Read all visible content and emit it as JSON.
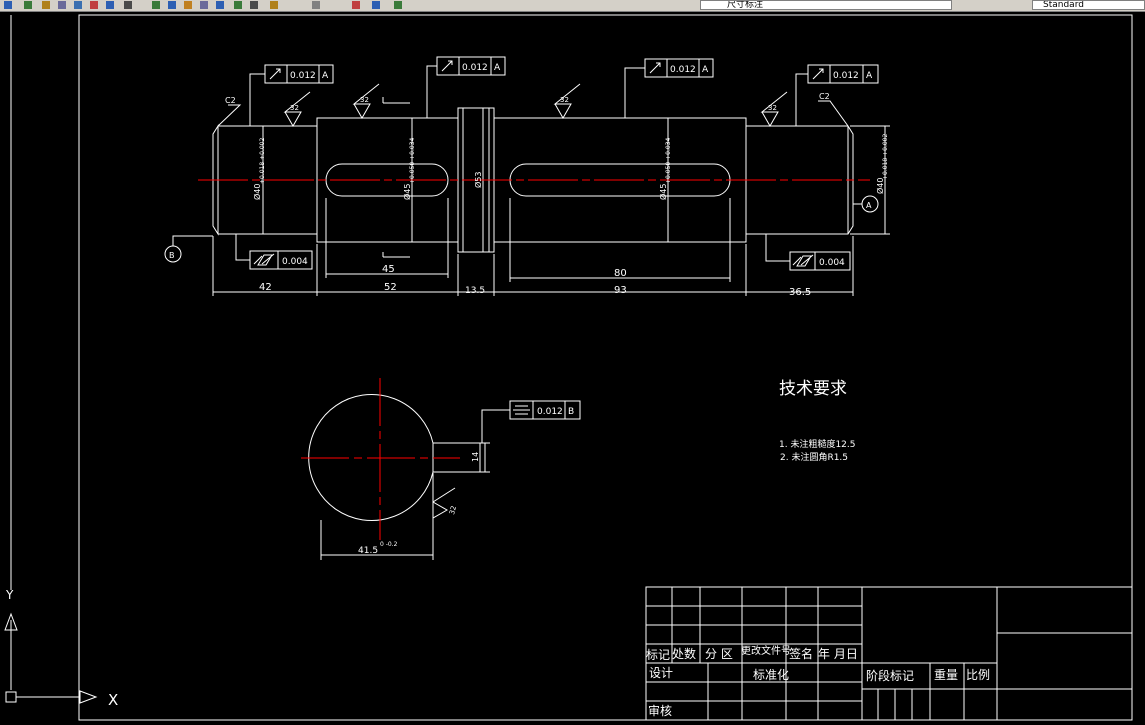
{
  "toolbar": {
    "layer_name": "尺寸标注",
    "text_style": "Standard",
    "icons": [
      "undo-icon",
      "save-icon",
      "cut-icon",
      "copy-icon",
      "paste-icon",
      "match-properties-icon",
      "pan-icon",
      "zoom-realtime-icon",
      "zoom-window-icon",
      "zoom-previous-icon",
      "properties-icon",
      "design-center-icon",
      "tool-palette-icon",
      "sheet-set-icon",
      "markup-icon",
      "calculator-icon",
      "help-icon",
      "layer-manager-icon",
      "layer-state-icon",
      "layer-previous-icon"
    ]
  },
  "drawing": {
    "colors": {
      "background": "#000000",
      "lines": "#ffffff",
      "centerline": "#ff0000"
    },
    "chamfer_labels": [
      "C2",
      "C2"
    ],
    "roughness_values": [
      "32",
      "32",
      "32",
      "32",
      "32"
    ],
    "tolerances": {
      "runout": [
        {
          "symbol": "circular-runout",
          "value": "0.012",
          "datum": "A"
        },
        {
          "symbol": "circular-runout",
          "value": "0.012",
          "datum": "A"
        },
        {
          "symbol": "circular-runout",
          "value": "0.012",
          "datum": "A"
        },
        {
          "symbol": "circular-runout",
          "value": "0.012",
          "datum": "A"
        }
      ],
      "cylindricity": [
        {
          "symbol": "cylindricity",
          "value": "0.004"
        },
        {
          "symbol": "cylindricity",
          "value": "0.004"
        }
      ],
      "symmetry": {
        "symbol": "symmetry",
        "value": "0.012",
        "datum": "B"
      }
    },
    "datums": [
      "A",
      "B"
    ],
    "diameters": {
      "left_journal": "Ø40",
      "left_journal_tol": "+0.018 +0.002",
      "left_keyseat_shaft": "Ø45",
      "left_keyseat_tol": "+0.050 +0.034",
      "collar": "Ø53",
      "right_keyseat_shaft": "Ø45",
      "right_keyseat_tol": "+0.050 +0.034",
      "right_journal": "Ø40",
      "right_journal_tol": "+0.018 +0.002"
    },
    "lengths": {
      "left_journal": "42",
      "left_shaft": "52",
      "left_key": "45",
      "collar": "13.5",
      "right_shaft": "93",
      "right_key": "80",
      "right_journal": "36.5"
    },
    "section": {
      "key_width": "14",
      "depth": "41.5",
      "depth_tol": "0 -0.2",
      "roughness": "32"
    },
    "tech_req": {
      "title": "技术要求",
      "items": [
        "1. 未注粗糙度12.5",
        "2. 未注圆角R1.5"
      ]
    },
    "title_block": {
      "headers": [
        "标记",
        "处数",
        "分 区",
        "更改文件号",
        "签名",
        "年 月日"
      ],
      "design": "设计",
      "standardize": "标准化",
      "review": "审核",
      "stage_mark": "阶段标记",
      "weight": "重量",
      "scale": "比例"
    },
    "ucs": {
      "x_label": "X",
      "y_label": "Y"
    }
  }
}
